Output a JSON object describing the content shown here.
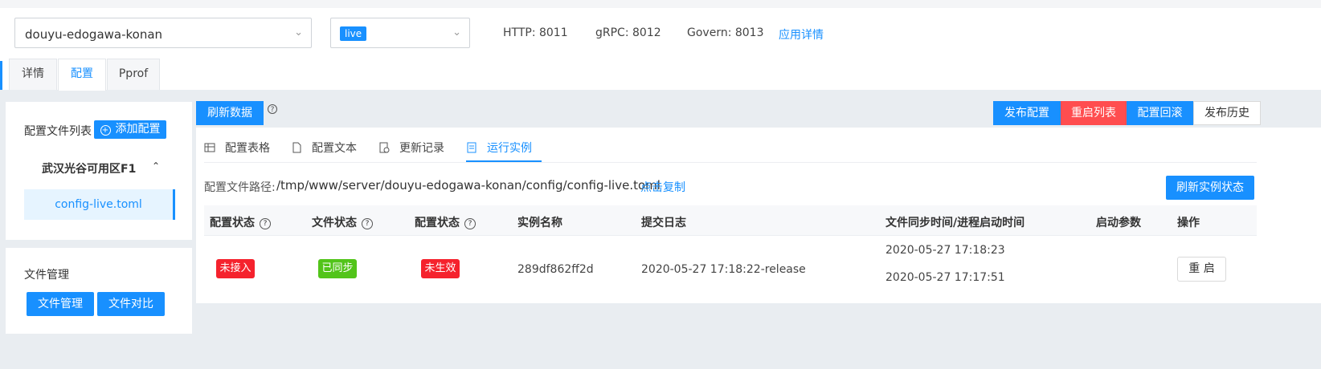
{
  "header": {
    "app_select": "douyu-edogawa-konan",
    "env_tag": "live",
    "http_port": "HTTP: 8011",
    "grpc_port": "gRPC: 8012",
    "govern_port": "Govern: 8013",
    "app_detail_link": "应用详情",
    "tabs": [
      "详情",
      "配置",
      "Pprof"
    ]
  },
  "sidebar": {
    "config_list_label": "配置文件列表",
    "add_config_button": "添加配置",
    "zone_name": "武汉光谷可用区F1",
    "config_file": "config-live.toml",
    "file_mgmt_label": "文件管理",
    "file_mgmt_button": "文件管理",
    "file_compare_button": "文件对比"
  },
  "toolbar": {
    "refresh_button": "刷新数据",
    "publish_button": "发布配置",
    "restart_list_button": "重启列表",
    "rollback_button": "配置回滚",
    "history_button": "发布历史"
  },
  "subtabs": [
    "配置表格",
    "配置文本",
    "更新记录",
    "运行实例"
  ],
  "path": {
    "label": "配置文件路径:",
    "value": "/tmp/www/server/douyu-edogawa-konan/config/config-live.toml",
    "copy_link": "点击复制",
    "refresh_status_button": "刷新实例状态"
  },
  "table": {
    "columns": [
      "配置状态",
      "文件状态",
      "配置状态",
      "实例名称",
      "提交日志",
      "文件同步时间/进程启动时间",
      "启动参数",
      "操作"
    ],
    "row": {
      "status1": "未接入",
      "status2": "已同步",
      "status3": "未生效",
      "instance": "289df862ff2d",
      "commit_log": "2020-05-27 17:18:22-release",
      "sync_time": "2020-05-27 17:18:23",
      "start_time": "2020-05-27 17:17:51",
      "action": "重 启"
    }
  },
  "colors": {
    "primary": "#1890ff",
    "danger": "#f5222d",
    "success": "#52c41a"
  }
}
